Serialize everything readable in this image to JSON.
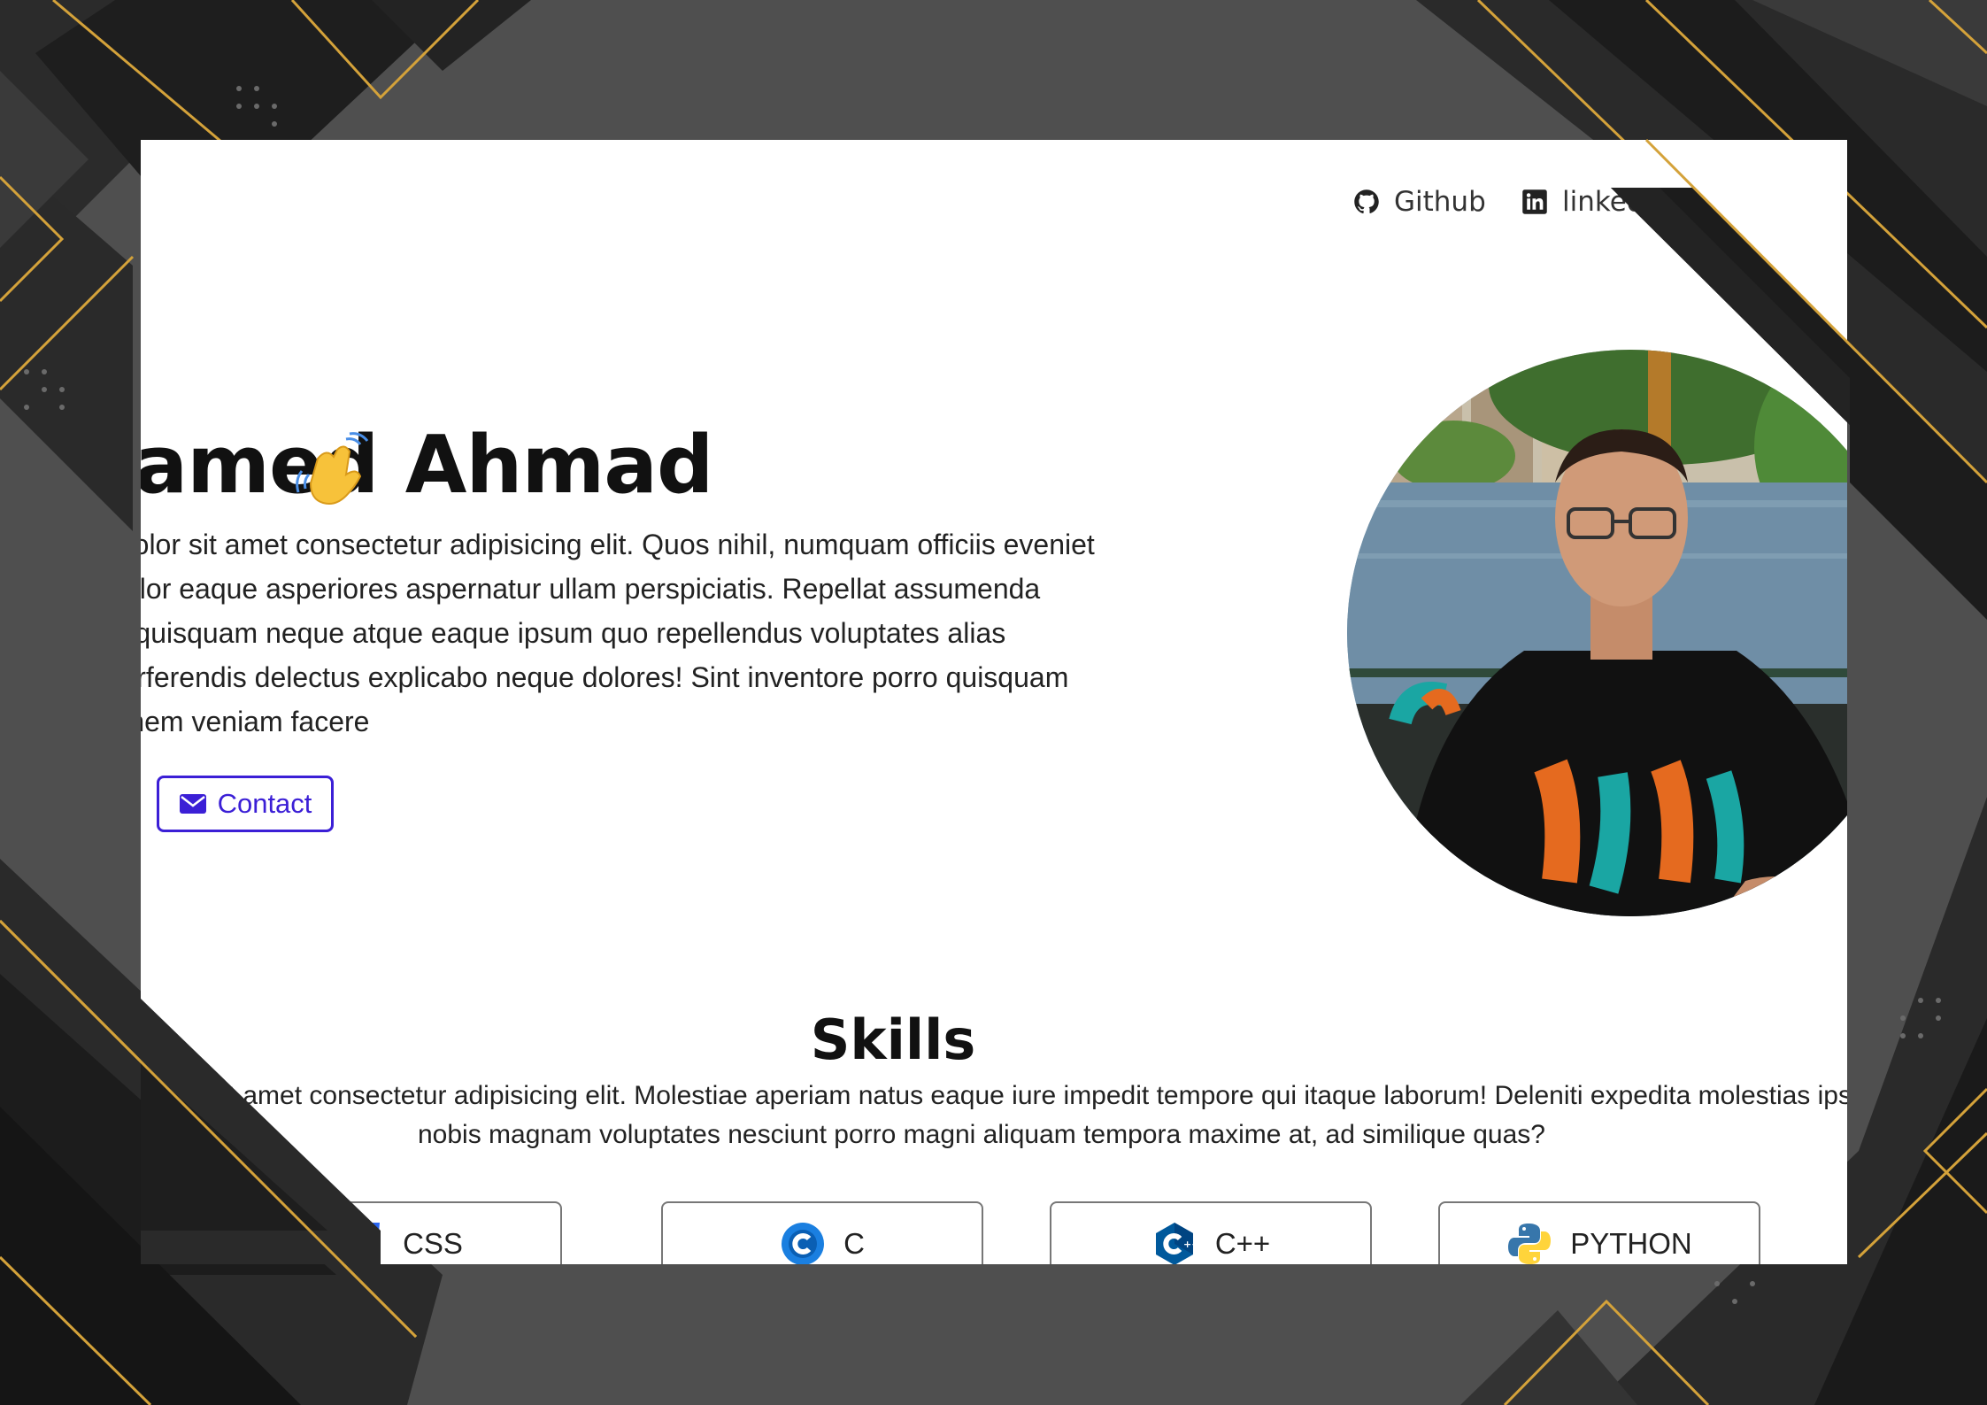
{
  "nav": {
    "github_label": "Github",
    "linkedin_label": "linkedin"
  },
  "hero": {
    "title": "Mohamed Ahmad",
    "description": "Lorem ipsum dolor sit amet consectetur adipisicing elit. Quos nihil, numquam officiis eveniet hic distinctio dolor eaque asperiores aspernatur ullam perspiciatis. Repellat assumenda corrupti facere quisquam neque atque eaque ipsum quo repellendus voluptates alias voluptatibus perferendis delectus explicabo neque dolores! Sint inventore porro quisquam eos exercitationem veniam facere",
    "contact_label": "Contact"
  },
  "skills": {
    "title": "Skills",
    "description": "Lorem ipsum dolor sit amet consectetur adipisicing elit. Molestiae aperiam natus eaque iure impedit tempore qui itaque laborum! Deleniti expedita molestias ipsa excepturi nobis magnam voluptates nesciunt porro magni aliquam tempora maxime at, ad similique quas?",
    "items": [
      {
        "label": "CSS",
        "icon": "css3-icon",
        "color": "#2965f1"
      },
      {
        "label": "C",
        "icon": "c-lang-icon",
        "color": "#1a7fe0"
      },
      {
        "label": "C++",
        "icon": "cpp-icon",
        "color": "#00599c"
      },
      {
        "label": "PYTHON",
        "icon": "python-icon",
        "color": "#3776ab"
      }
    ]
  },
  "colors": {
    "accent": "#3b1fd6",
    "frame_dark": "#1c1c1c",
    "frame_gold": "#d4a23a"
  }
}
